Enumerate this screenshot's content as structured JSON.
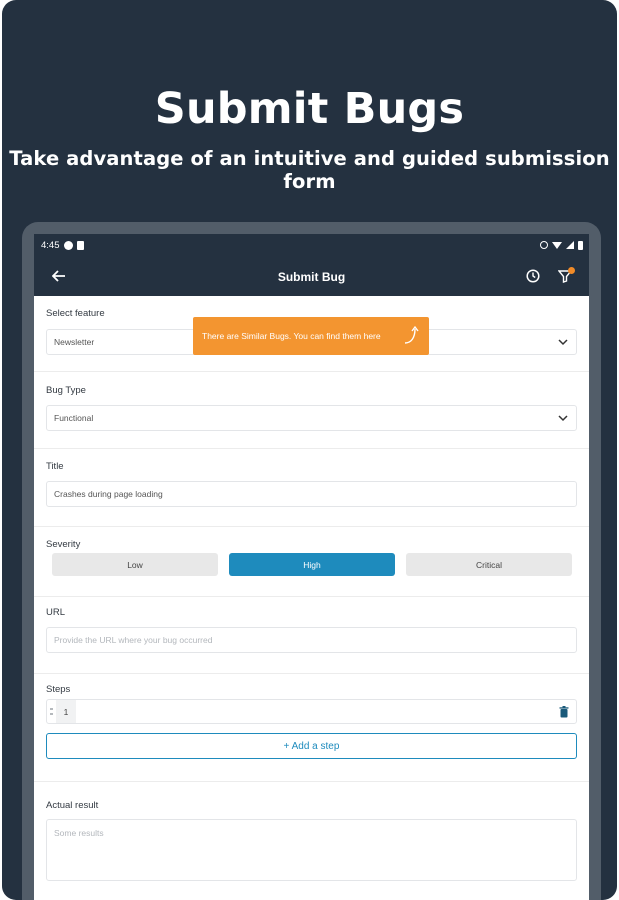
{
  "promo": {
    "title": "Submit Bugs",
    "subtitle": "Take advantage of an intuitive and guided submission form"
  },
  "statusbar": {
    "time": "4:45"
  },
  "appbar": {
    "title": "Submit Bug",
    "back_icon": "arrow-left-icon",
    "history_icon": "clock-icon",
    "filter_icon": "funnel-icon"
  },
  "form": {
    "feature": {
      "label": "Select feature",
      "value": "Newsletter"
    },
    "tooltip": {
      "text": "There are Similar Bugs. You can find them here"
    },
    "bug_type": {
      "label": "Bug Type",
      "value": "Functional"
    },
    "title": {
      "label": "Title",
      "value": "Crashes during page loading"
    },
    "severity": {
      "label": "Severity",
      "options": [
        "Low",
        "High",
        "Critical"
      ],
      "selected": "High"
    },
    "url": {
      "label": "URL",
      "placeholder": "Provide the URL where your bug occurred"
    },
    "steps": {
      "label": "Steps",
      "items": [
        {
          "number": "1",
          "text": ""
        }
      ],
      "add_label": "+ Add a step"
    },
    "actual_result": {
      "label": "Actual result",
      "placeholder": "Some results"
    }
  },
  "colors": {
    "header_bg": "#243140",
    "accent": "#1e8bbd",
    "tooltip": "#f39530"
  }
}
